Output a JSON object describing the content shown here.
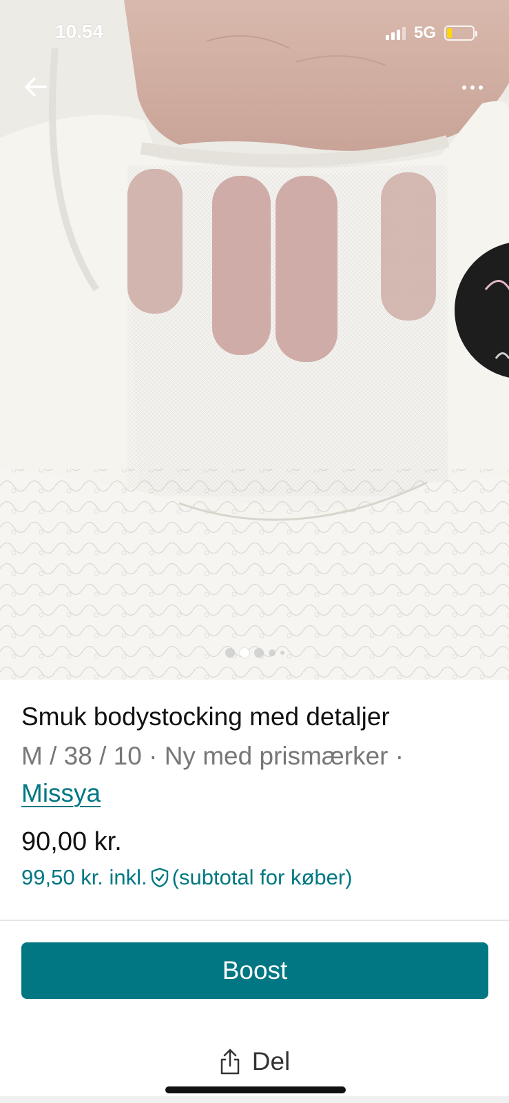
{
  "status_bar": {
    "time": "10.54",
    "network": "5G",
    "battery_level_fraction": 0.2
  },
  "nav": {
    "back_icon": "arrow-left-icon",
    "more_icon": "more-horizontal-icon"
  },
  "photo": {
    "page_count": 5,
    "active_index": 1
  },
  "item": {
    "title": "Smuk bodystocking med detaljer",
    "meta": "M / 38 / 10 · Ny med prismærker ·",
    "brand": "Missya",
    "price": "90,00 kr.",
    "buyer_price": "99,50 kr. inkl.",
    "buyer_price_note": "(subtotal for køber)"
  },
  "actions": {
    "boost_label": "Boost",
    "share_label": "Del"
  },
  "colors": {
    "accent": "#007782",
    "text": "#111111",
    "muted": "#777777"
  }
}
